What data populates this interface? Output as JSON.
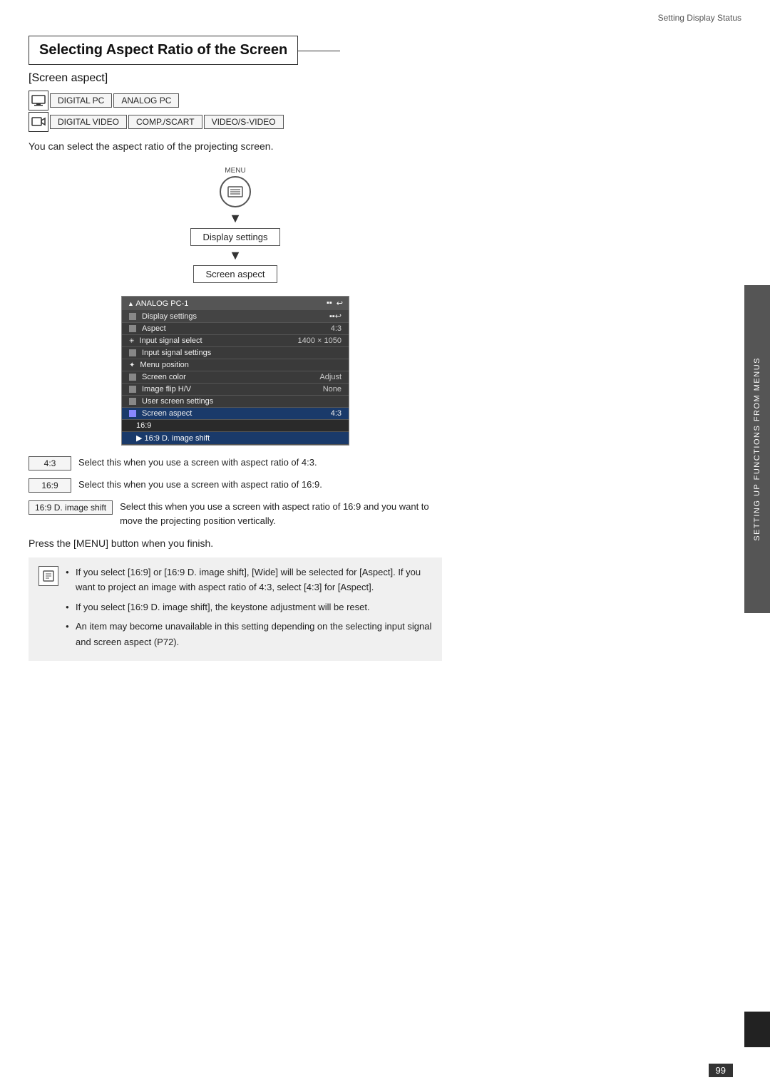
{
  "header": {
    "title": "Setting Display Status"
  },
  "page": {
    "title": "Selecting Aspect Ratio of the Screen",
    "section_label": "[Screen aspect]",
    "input_row1": [
      "DIGITAL PC",
      "ANALOG PC"
    ],
    "input_row2": [
      "DIGITAL VIDEO",
      "COMP./SCART",
      "VIDEO/S-VIDEO"
    ],
    "description": "You can select the aspect ratio of the projecting screen.",
    "menu_label": "MENU",
    "flow_step1": "Display settings",
    "flow_step2": "Screen aspect",
    "osd": {
      "title": "ANALOG PC-1",
      "icons": [
        "▪▪",
        "↩"
      ],
      "rows": [
        {
          "label": "Display settings",
          "value": "",
          "icon": true,
          "type": "header"
        },
        {
          "label": "Aspect",
          "value": "4:3",
          "type": "normal"
        },
        {
          "label": "Input signal select",
          "value": "1400 × 1050",
          "type": "normal"
        },
        {
          "label": "Input signal settings",
          "value": "",
          "type": "normal"
        },
        {
          "label": "Menu position",
          "value": "",
          "type": "normal"
        },
        {
          "label": "Screen color",
          "value": "Adjust",
          "type": "normal"
        },
        {
          "label": "Image flip H/V",
          "value": "None",
          "type": "normal"
        },
        {
          "label": "User screen settings",
          "value": "",
          "type": "normal"
        },
        {
          "label": "Screen aspect",
          "value": "4:3",
          "type": "highlight"
        }
      ],
      "submenu": [
        {
          "label": "16:9",
          "type": "submenu-item"
        },
        {
          "label": "▶ 16:9 D. image shift",
          "type": "submenu-selected"
        }
      ]
    },
    "options": [
      {
        "label": "4:3",
        "desc": "Select this when you use a screen with aspect ratio of 4:3."
      },
      {
        "label": "16:9",
        "desc": "Select this when you use a screen with aspect ratio of 16:9."
      },
      {
        "label": "16:9 D. image shift",
        "desc": "Select this when you use a screen with aspect ratio of 16:9 and you want to move the projecting position vertically."
      }
    ],
    "press_note": "Press the [MENU] button when you finish.",
    "notes": [
      "If you select [16:9] or [16:9 D. image shift], [Wide] will be selected for [Aspect]. If you want to project an image with aspect ratio of 4:3, select [4:3] for [Aspect].",
      "If you select [16:9 D. image shift], the keystone adjustment will be reset.",
      "An item may become unavailable in this setting depending on the selecting input signal and screen aspect (P72)."
    ]
  },
  "sidebar": {
    "text": "SETTING UP FUNCTIONS FROM MENUS"
  },
  "page_number": "99"
}
